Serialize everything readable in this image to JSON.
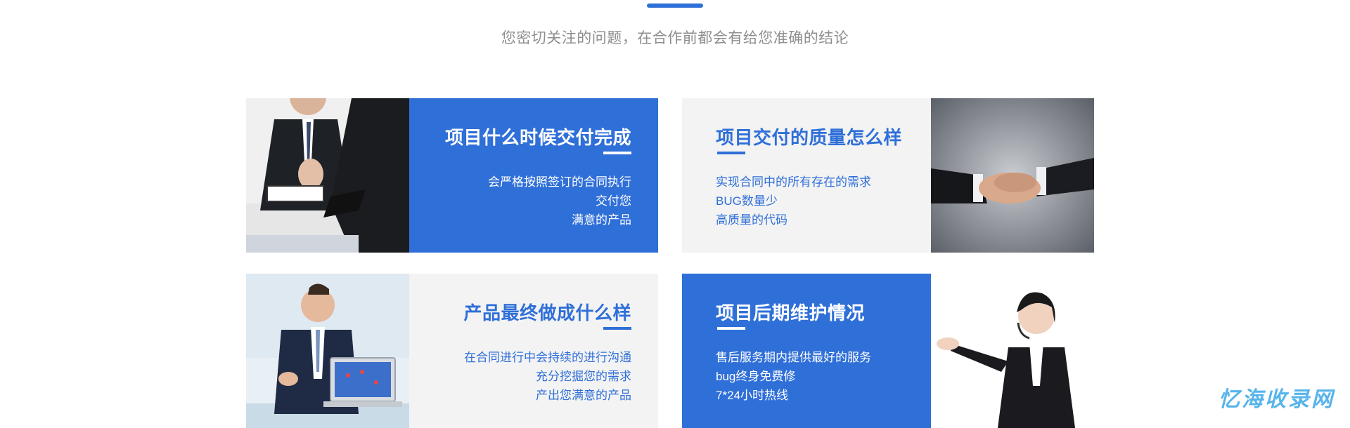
{
  "header": {
    "subtitle": "您密切关注的问题，在合作前都会有给您准确的结论",
    "accent_color": "#2f6fd8"
  },
  "cards": [
    {
      "title": "项目什么时候交付完成",
      "lines": [
        "会严格按照签订的合同执行",
        "交付您",
        "满意的产品"
      ],
      "panel_style": "blue",
      "image": "business-meeting-photo"
    },
    {
      "title": "项目交付的质量怎么样",
      "lines": [
        "实现合同中的所有存在的需求",
        "BUG数量少",
        "高质量的代码"
      ],
      "panel_style": "gray",
      "image": "handshake-photo"
    },
    {
      "title": "产品最终做成什么样",
      "lines": [
        "在合同进行中会持续的进行沟通",
        "充分挖掘您的需求",
        "产出您满意的产品"
      ],
      "panel_style": "gray",
      "image": "businessman-laptop-photo"
    },
    {
      "title": "项目后期维护情况",
      "lines": [
        "售后服务期内提供最好的服务",
        "bug终身免费修",
        "7*24小时热线"
      ],
      "panel_style": "blue",
      "image": "customer-service-photo"
    }
  ],
  "watermark": "忆海收录网",
  "colors": {
    "blue": "#2f6fd8",
    "gray_panel": "#f3f3f3",
    "subtitle_gray": "#8e8e8e"
  }
}
